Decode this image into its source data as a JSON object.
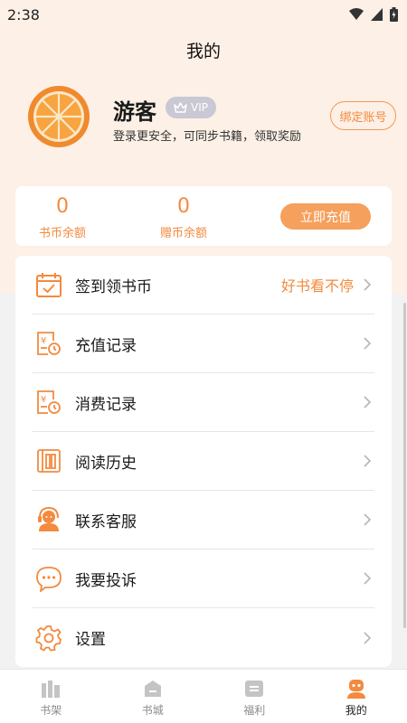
{
  "status_bar": {
    "time": "2:38"
  },
  "page": {
    "title": "我的"
  },
  "profile": {
    "name": "游客",
    "vip_label": "VIP",
    "subtitle": "登录更安全，可同步书籍，领取奖励",
    "bind_button": "绑定账号"
  },
  "balance": {
    "coin_value": "0",
    "coin_label": "书币余额",
    "gift_value": "0",
    "gift_label": "赠币余额",
    "recharge_button": "立即充值"
  },
  "menu": {
    "items": [
      {
        "label": "签到领书币",
        "extra": "好书看不停",
        "icon": "calendar-checkin-icon"
      },
      {
        "label": "充值记录",
        "icon": "recharge-record-icon"
      },
      {
        "label": "消费记录",
        "icon": "consume-record-icon"
      },
      {
        "label": "阅读历史",
        "icon": "reading-history-icon"
      },
      {
        "label": "联系客服",
        "icon": "customer-service-icon"
      },
      {
        "label": "我要投诉",
        "icon": "complaint-chat-icon"
      },
      {
        "label": "设置",
        "icon": "settings-gear-icon"
      }
    ]
  },
  "tabs": [
    {
      "label": "书架",
      "icon": "bookshelf-icon",
      "active": false
    },
    {
      "label": "书城",
      "icon": "bookstore-icon",
      "active": false
    },
    {
      "label": "福利",
      "icon": "welfare-icon",
      "active": false
    },
    {
      "label": "我的",
      "icon": "profile-icon",
      "active": true
    }
  ],
  "colors": {
    "accent": "#f38a3e",
    "button_fill": "#f5a05c",
    "header_bg": "#fdf0e6",
    "page_bg": "#f2f2f2",
    "vip_badge": "#c9c8d4"
  }
}
